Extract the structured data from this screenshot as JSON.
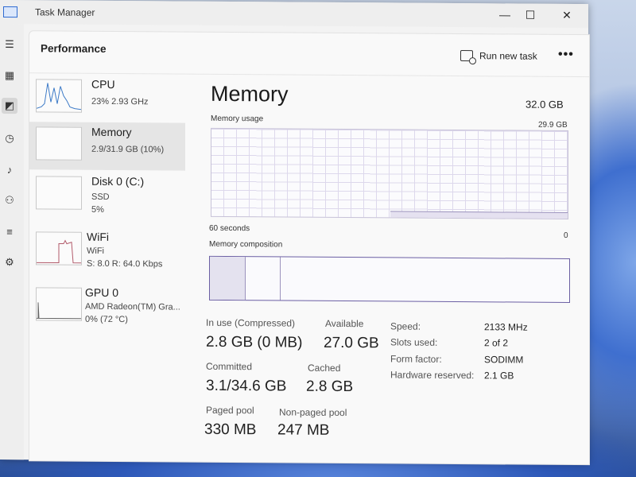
{
  "window": {
    "title": "Task Manager",
    "minimize": "—",
    "maximize": "☐",
    "close": "✕"
  },
  "rail": {
    "icons": [
      "hamburger-icon",
      "processes-icon",
      "performance-icon",
      "app-history-icon",
      "startup-icon",
      "users-icon",
      "details-icon",
      "services-icon"
    ]
  },
  "header": {
    "title": "Performance",
    "run_task_label": "Run new task",
    "more": "•••"
  },
  "sidebar": {
    "items": [
      {
        "name": "CPU",
        "line1": "23% 2.93 GHz",
        "line2": ""
      },
      {
        "name": "Memory",
        "line1": "2.9/31.9 GB (10%)",
        "line2": ""
      },
      {
        "name": "Disk 0 (C:)",
        "line1": "SSD",
        "line2": "5%"
      },
      {
        "name": "WiFi",
        "line1": "WiFi",
        "line2": "S: 8.0 R: 64.0 Kbps"
      },
      {
        "name": "GPU 0",
        "line1": "AMD Radeon(TM) Gra...",
        "line2": "0% (72 °C)"
      }
    ]
  },
  "main": {
    "title": "Memory",
    "total": "32.0 GB",
    "usage_label": "Memory usage",
    "usage_max": "29.9 GB",
    "time_label": "60 seconds",
    "time_zero": "0",
    "composition_label": "Memory composition",
    "stats": {
      "in_use_label": "In use (Compressed)",
      "in_use_value": "2.8 GB (0 MB)",
      "available_label": "Available",
      "available_value": "27.0 GB",
      "committed_label": "Committed",
      "committed_value": "3.1/34.6 GB",
      "cached_label": "Cached",
      "cached_value": "2.8 GB",
      "paged_label": "Paged pool",
      "paged_value": "330 MB",
      "nonpaged_label": "Non-paged pool",
      "nonpaged_value": "247 MB"
    },
    "details": [
      {
        "label": "Speed:",
        "value": "2133 MHz"
      },
      {
        "label": "Slots used:",
        "value": "2 of 2"
      },
      {
        "label": "Form factor:",
        "value": "SODIMM"
      },
      {
        "label": "Hardware reserved:",
        "value": "2.1 GB"
      }
    ]
  },
  "colors": {
    "accent": "#6b5fa3",
    "graph_grid": "#ddd8ec",
    "selected": "#e5e5e5"
  }
}
